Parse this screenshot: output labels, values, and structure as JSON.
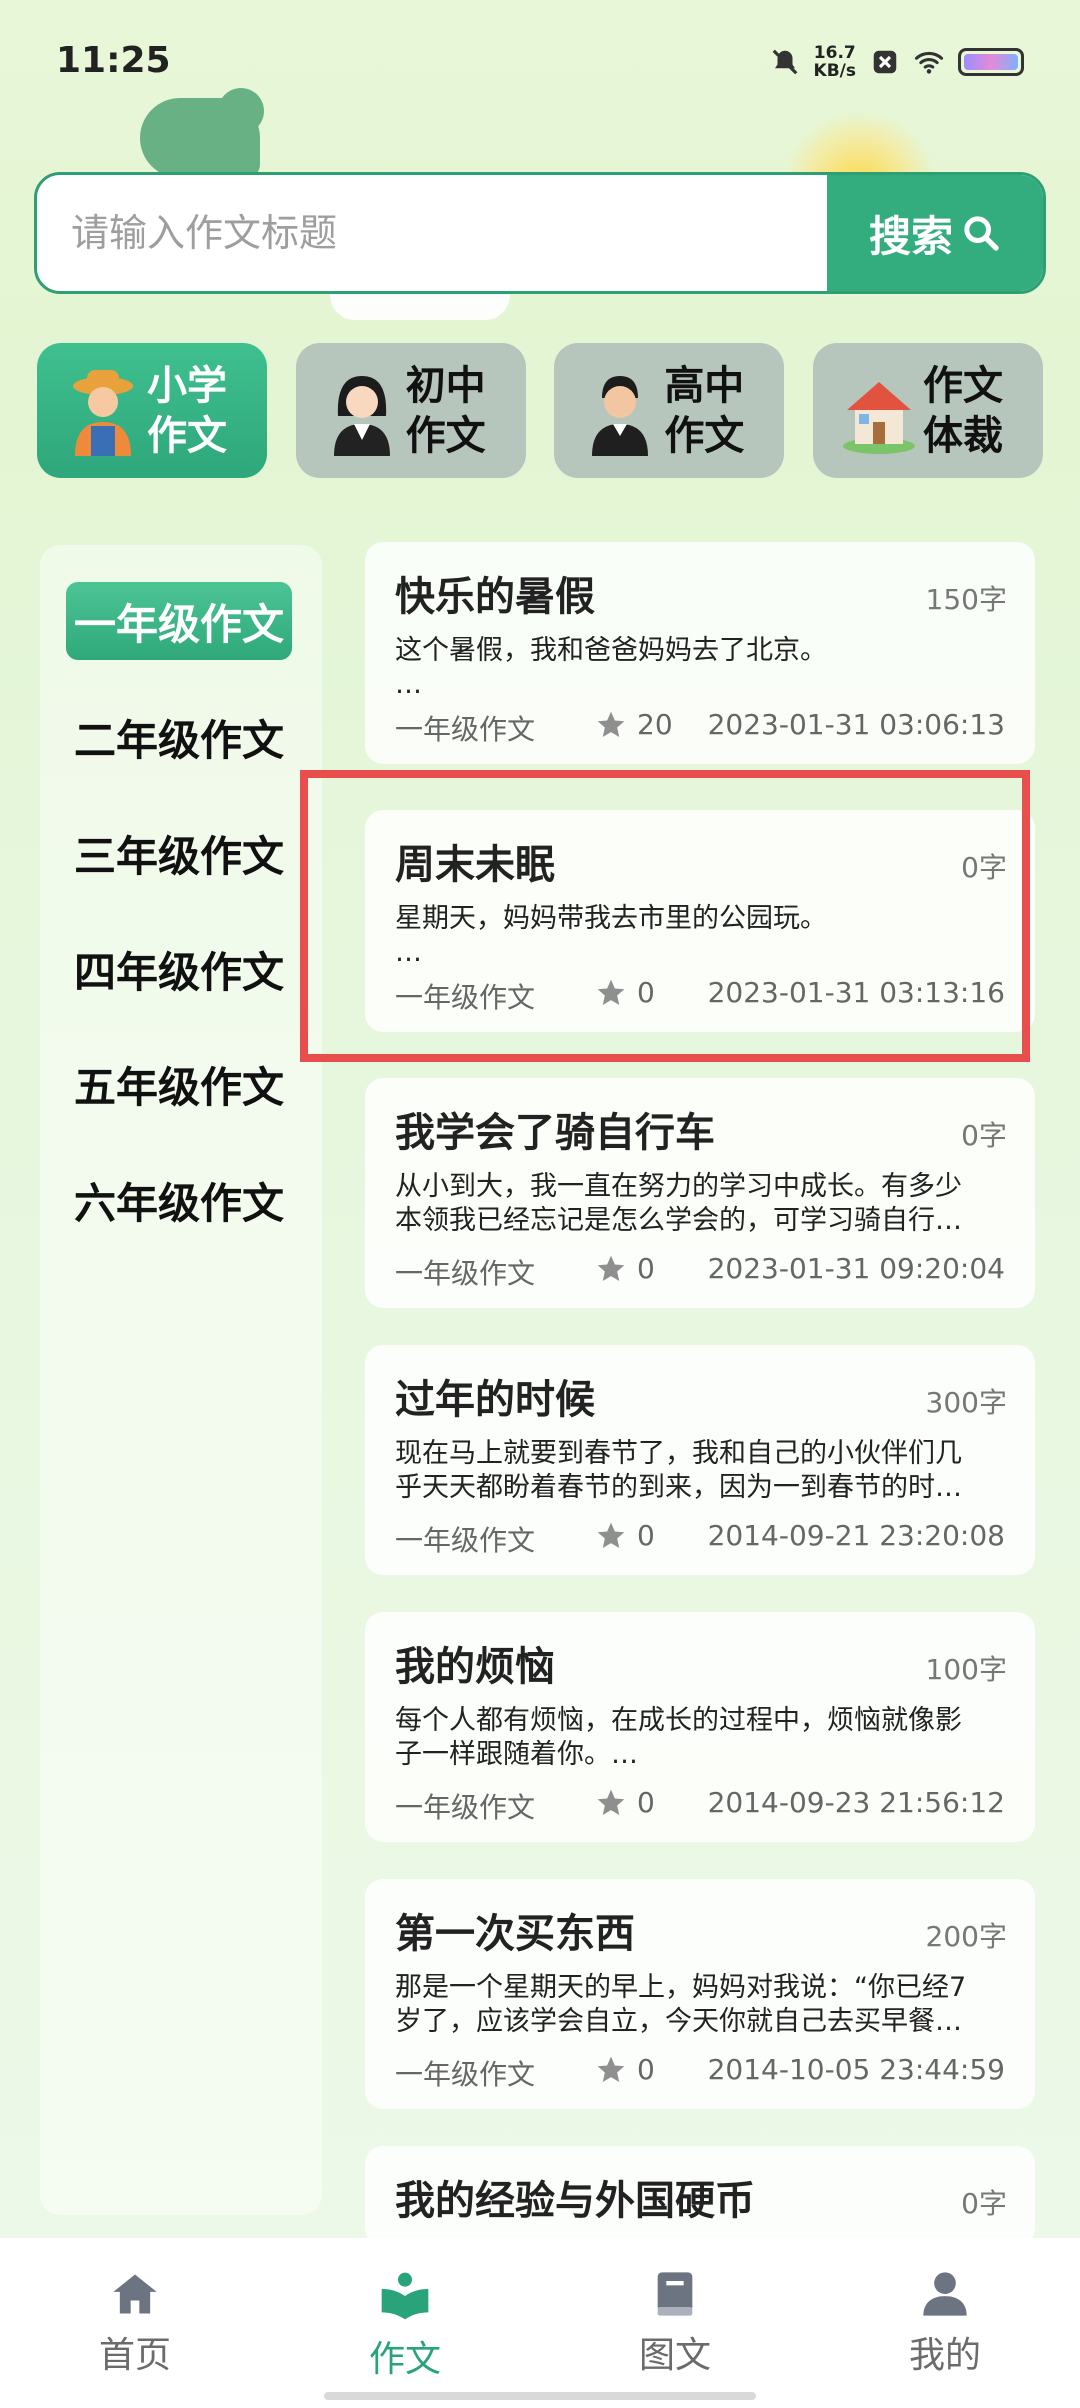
{
  "status_bar": {
    "time": "11:25",
    "speed_value": "16.7",
    "speed_unit": "KB/s"
  },
  "search": {
    "placeholder": "请输入作文标题",
    "button_label": "搜索"
  },
  "categories": [
    {
      "label_line1": "小学",
      "label_line2": "作文",
      "active": true
    },
    {
      "label_line1": "初中",
      "label_line2": "作文",
      "active": false
    },
    {
      "label_line1": "高中",
      "label_line2": "作文",
      "active": false
    },
    {
      "label_line1": "作文",
      "label_line2": "体裁",
      "active": false
    }
  ],
  "grades": [
    "一年级作文",
    "二年级作文",
    "三年级作文",
    "四年级作文",
    "五年级作文",
    "六年级作文"
  ],
  "articles": [
    {
      "title": "快乐的暑假",
      "words": "150字",
      "excerpt_line1": "这个暑假，我和爸爸妈妈去了北京。",
      "excerpt_line2": "…",
      "category": "一年级作文",
      "favorites": "20",
      "date": "2023-01-31 03:06:13"
    },
    {
      "title": "周末未眠",
      "words": "0字",
      "excerpt_line1": "星期天，妈妈带我去市里的公园玩。",
      "excerpt_line2": "…",
      "category": "一年级作文",
      "favorites": "0",
      "date": "2023-01-31 03:13:16"
    },
    {
      "title": "我学会了骑自行车",
      "words": "0字",
      "excerpt_line1": "从小到大，我一直在努力的学习中成长。有多少",
      "excerpt_line2": "本领我已经忘记是怎么学会的，可学习骑自行…",
      "category": "一年级作文",
      "favorites": "0",
      "date": "2023-01-31 09:20:04"
    },
    {
      "title": "过年的时候",
      "words": "300字",
      "excerpt_line1": "现在马上就要到春节了，我和自己的小伙伴们几",
      "excerpt_line2": "乎天天都盼着春节的到来，因为一到春节的时…",
      "category": "一年级作文",
      "favorites": "0",
      "date": "2014-09-21 23:20:08"
    },
    {
      "title": "我的烦恼",
      "words": "100字",
      "excerpt_line1": "每个人都有烦恼，在成长的过程中，烦恼就像影",
      "excerpt_line2": "子一样跟随着你。…",
      "category": "一年级作文",
      "favorites": "0",
      "date": "2014-09-23 21:56:12"
    },
    {
      "title": "第一次买东西",
      "words": "200字",
      "excerpt_line1": "那是一个星期天的早上，妈妈对我说：“你已经7",
      "excerpt_line2": "岁了，应该学会自立，今天你就自己去买早餐…",
      "category": "一年级作文",
      "favorites": "0",
      "date": "2014-10-05 23:44:59"
    },
    {
      "title": "我的经验与外国硬币",
      "words": "0字"
    }
  ],
  "bottom_nav": [
    {
      "label": "首页",
      "icon": "home-icon",
      "active": false
    },
    {
      "label": "作文",
      "icon": "open-book-icon",
      "active": true
    },
    {
      "label": "图文",
      "icon": "book-icon",
      "active": false
    },
    {
      "label": "我的",
      "icon": "user-icon",
      "active": false
    }
  ],
  "colors": {
    "accent": "#33ad7e",
    "highlight": "#e84f4c",
    "inactive_category": "#b7c6bc"
  }
}
